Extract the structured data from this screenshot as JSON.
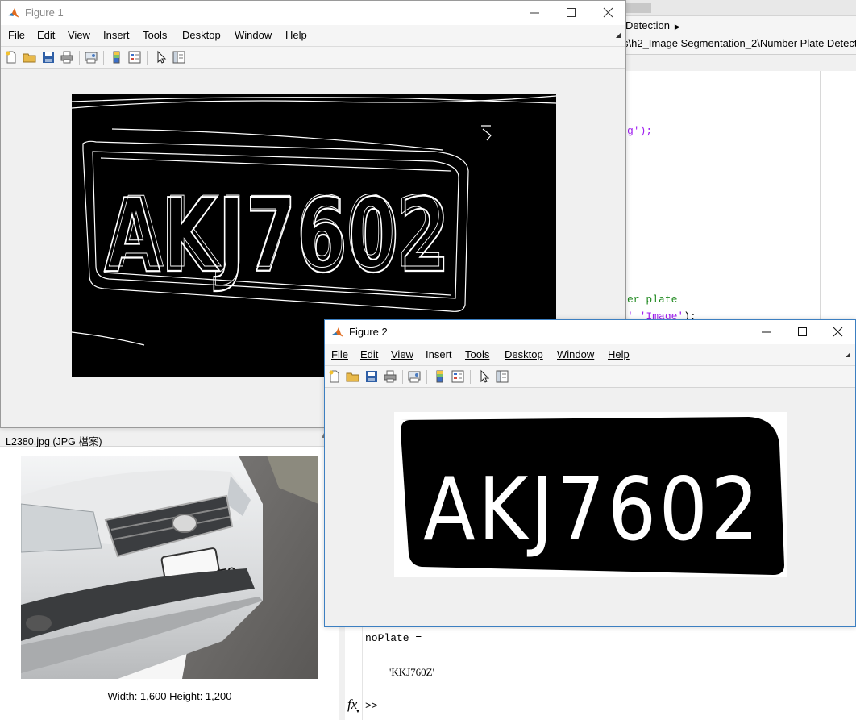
{
  "background": {
    "breadcrumb": "Detection",
    "current_path": "s\\h2_Image Segmentation_2\\Number Plate Detect",
    "editor": {
      "line1": "g');",
      "line2": "er plate",
      "line3_a": "' ",
      "line3_b": "'Image'",
      "line3_c": ");"
    },
    "command_window": {
      "output_var": "noPlate =",
      "output_value": "'KKJ760Z'",
      "prompt": ">>",
      "fx_label": "fx"
    }
  },
  "details_panel": {
    "title": "L2380.jpg  (JPG 檔案)",
    "dimensions": "Width: 1,600 Height: 1,200",
    "plate_text": "2380-T9"
  },
  "figure1": {
    "title": "Figure 1",
    "menu": [
      "File",
      "Edit",
      "View",
      "Insert",
      "Tools",
      "Desktop",
      "Window",
      "Help"
    ],
    "image_plate_text": "AKJ7602"
  },
  "figure2": {
    "title": "Figure 2",
    "menu": [
      "File",
      "Edit",
      "View",
      "Insert",
      "Tools",
      "Desktop",
      "Window",
      "Help"
    ],
    "image_plate_text": "AKJ7602"
  },
  "colors": {
    "accent": "#3c7fc1",
    "matlab_orange": "#e06b1f",
    "comment_green": "#228b22",
    "string_purple": "#a020f0"
  },
  "icons": [
    "matlab-icon",
    "minimize-icon",
    "maximize-icon",
    "close-icon",
    "new-figure-icon",
    "open-file-icon",
    "save-icon",
    "print-icon",
    "print-preview-icon",
    "colorbar-icon",
    "legend-icon",
    "edit-plot-icon",
    "property-inspector-icon"
  ]
}
